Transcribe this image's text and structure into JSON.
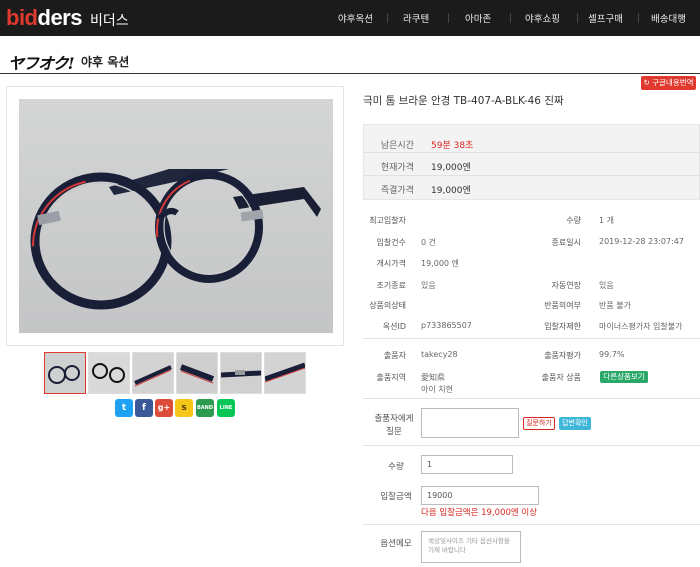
{
  "header": {
    "logo_left": "bid",
    "logo_right": "ders",
    "logo_kr": "비더스",
    "nav": [
      "야후옥션",
      "라쿠텐",
      "아마존",
      "야후쇼핑",
      "셀프구매",
      "배송대행"
    ]
  },
  "section": {
    "brand_logo": "ヤフオク!",
    "title": "야후 옥션"
  },
  "share_icons": [
    "twitter-icon",
    "facebook-icon",
    "google-plus-icon",
    "kakaostory-icon",
    "band-icon",
    "line-icon"
  ],
  "translate_button": "구글내용번역",
  "product": {
    "title": "극미 톰 브라운 안경 TB-407-A-BLK-46 진짜"
  },
  "price": {
    "remaining_label": "남은시간",
    "remaining_value": "59분 38초",
    "current_label": "현재가격",
    "current_value": "19,000엔",
    "buyout_label": "즉결가격",
    "buyout_value": "19,000엔"
  },
  "info": {
    "top_bidder_label": "최고입찰자",
    "top_bidder_value": "",
    "quantity_label": "수량",
    "quantity_value": "1 개",
    "bid_count_label": "입찰건수",
    "bid_count_value": "0 건",
    "end_date_label": "종료일시",
    "end_date_value": "2019-12-28 23:07:47",
    "start_price_label": "개시가격",
    "start_price_value": "19,000 엔",
    "early_end_label": "조기종료",
    "early_end_value": "있음",
    "auto_extend_label": "자동연장",
    "auto_extend_value": "있음",
    "condition_label": "상품의상태",
    "condition_value": "",
    "returns_label": "반품의여부",
    "returns_value": "반품 불가",
    "auction_id_label": "옥션ID",
    "auction_id_value": "p733865507",
    "restriction_label": "입찰자제한",
    "restriction_value": "마이너스평가자 입찰불가"
  },
  "seller": {
    "seller_label": "출품자",
    "seller_value": "takecy28",
    "rating_label": "출품자평가",
    "rating_value": "99.7%",
    "region_label": "출품지역",
    "region_value_1": "愛知県",
    "region_value_2": "아이 치현",
    "products_label": "출품자 상품",
    "other_products_button": "다른상품보기"
  },
  "question": {
    "label_1": "출품자에게",
    "label_2": "질문",
    "ask_button": "질문하기",
    "answer_button": "답변확인"
  },
  "form": {
    "quantity_label": "수량",
    "quantity_value": "1",
    "bid_label": "입찰금액",
    "bid_value": "19000",
    "bid_note": "다음 입찰금액은 19,000엔 이상",
    "memo_label": "옵션메모",
    "memo_placeholder": "색상및사이즈 기타 옵션사항을 기제 바랍니다"
  },
  "colors": {
    "accent_red": "#d8261f",
    "header_bg": "#1b1b1b",
    "green": "#2aa86a",
    "cyan": "#3fb7d9"
  }
}
